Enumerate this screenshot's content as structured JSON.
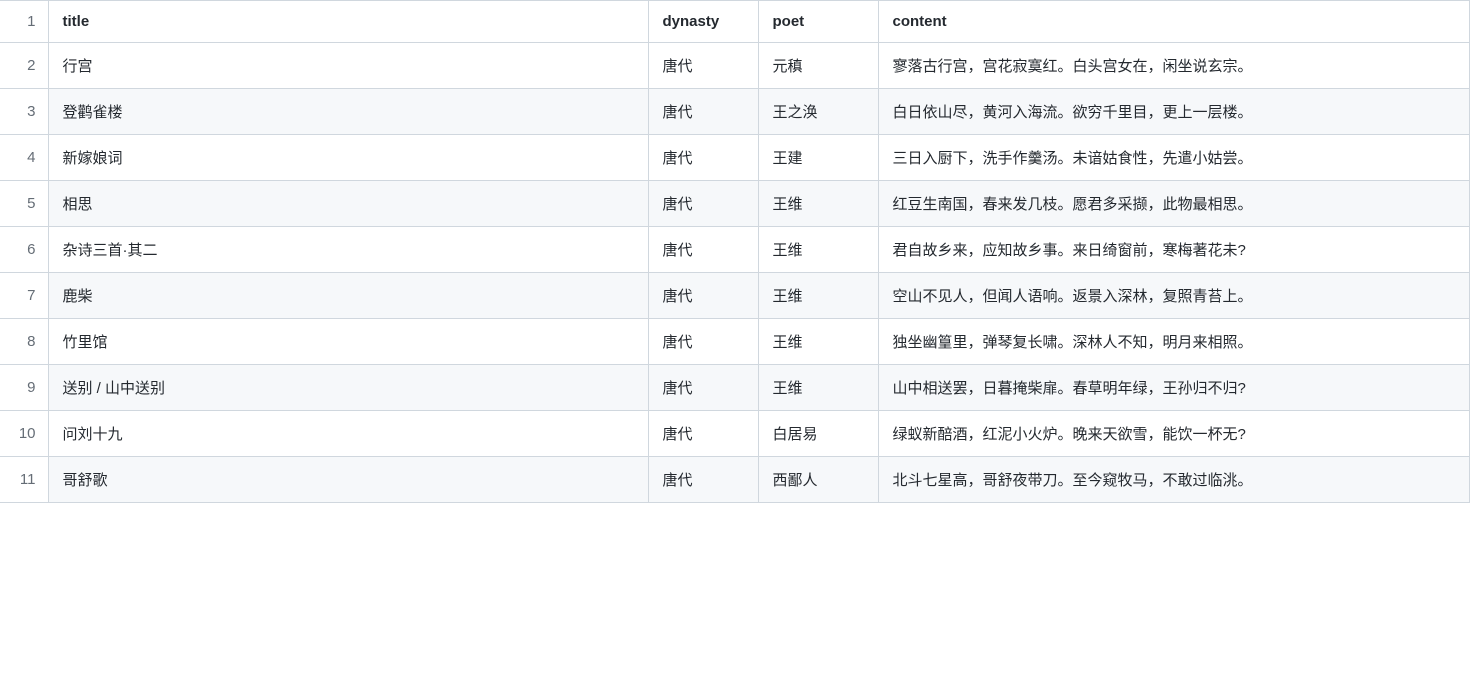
{
  "table": {
    "headerRowNumber": "1",
    "columns": [
      {
        "key": "title",
        "label": "title"
      },
      {
        "key": "dynasty",
        "label": "dynasty"
      },
      {
        "key": "poet",
        "label": "poet"
      },
      {
        "key": "content",
        "label": "content"
      }
    ],
    "rows": [
      {
        "num": "2",
        "title": "行宫",
        "dynasty": "唐代",
        "poet": "元稹",
        "content": "寥落古行宫，宫花寂寞红。白头宫女在，闲坐说玄宗。"
      },
      {
        "num": "3",
        "title": "登鹳雀楼",
        "dynasty": "唐代",
        "poet": "王之涣",
        "content": "白日依山尽，黄河入海流。欲穷千里目，更上一层楼。"
      },
      {
        "num": "4",
        "title": "新嫁娘词",
        "dynasty": "唐代",
        "poet": "王建",
        "content": "三日入厨下，洗手作羹汤。未谙姑食性，先遣小姑尝。"
      },
      {
        "num": "5",
        "title": "相思",
        "dynasty": "唐代",
        "poet": "王维",
        "content": "红豆生南国，春来发几枝。愿君多采撷，此物最相思。"
      },
      {
        "num": "6",
        "title": "杂诗三首·其二",
        "dynasty": "唐代",
        "poet": "王维",
        "content": "君自故乡来，应知故乡事。来日绮窗前，寒梅著花未?"
      },
      {
        "num": "7",
        "title": "鹿柴",
        "dynasty": "唐代",
        "poet": "王维",
        "content": "空山不见人，但闻人语响。返景入深林，复照青苔上。"
      },
      {
        "num": "8",
        "title": "竹里馆",
        "dynasty": "唐代",
        "poet": "王维",
        "content": "独坐幽篁里，弹琴复长啸。深林人不知，明月来相照。"
      },
      {
        "num": "9",
        "title": "送别 / 山中送别",
        "dynasty": "唐代",
        "poet": "王维",
        "content": "山中相送罢，日暮掩柴扉。春草明年绿，王孙归不归?"
      },
      {
        "num": "10",
        "title": "问刘十九",
        "dynasty": "唐代",
        "poet": "白居易",
        "content": "绿蚁新醅酒，红泥小火炉。晚来天欲雪，能饮一杯无?"
      },
      {
        "num": "11",
        "title": "哥舒歌",
        "dynasty": "唐代",
        "poet": "西鄙人",
        "content": "北斗七星高，哥舒夜带刀。至今窥牧马，不敢过临洮。"
      }
    ]
  }
}
